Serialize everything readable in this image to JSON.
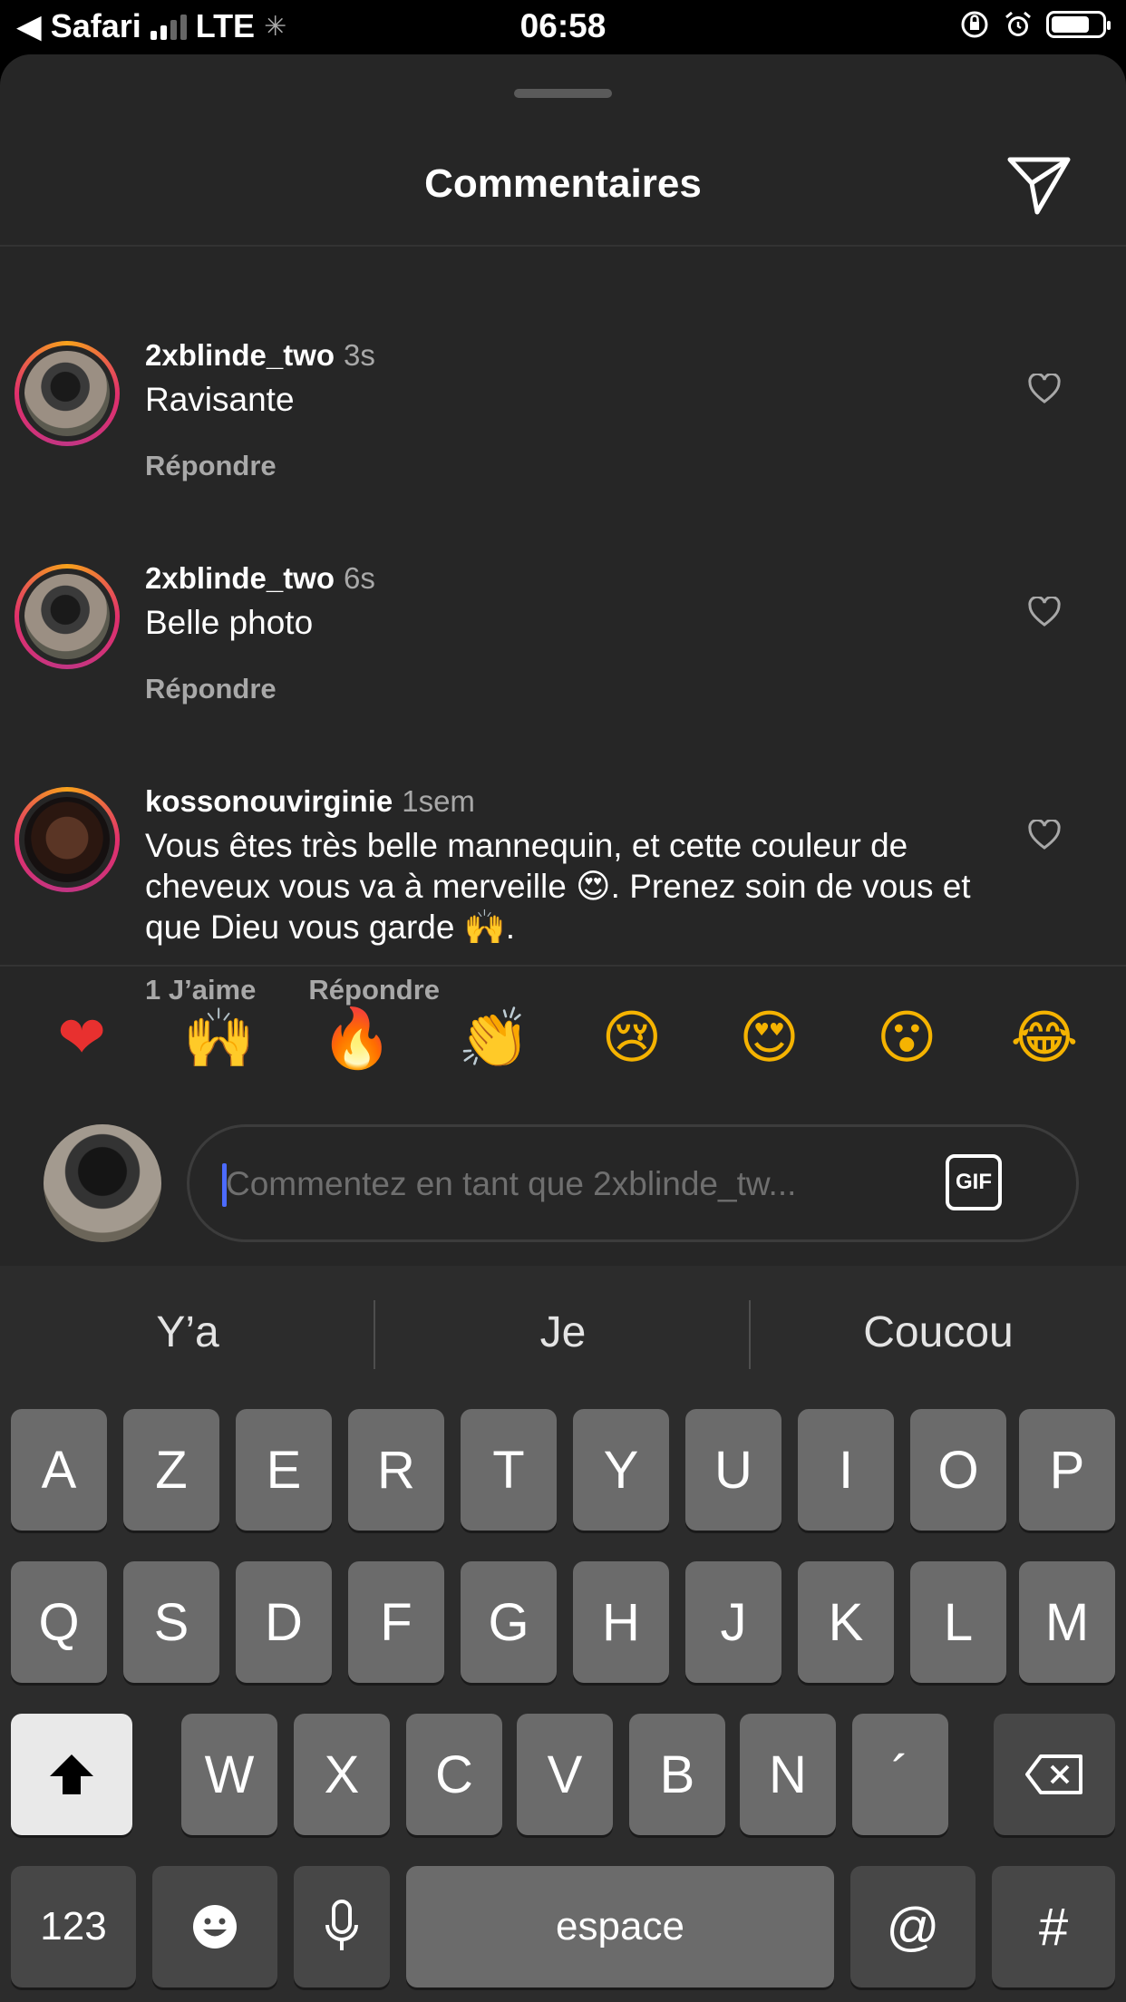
{
  "status_bar": {
    "back_label": "◀ Safari",
    "carrier": "LTE",
    "time": "06:58",
    "battery_level": 0.75
  },
  "sheet": {
    "title": "Commentaires",
    "comments": [
      {
        "username": "2xblinde_two",
        "ago": "3s",
        "text": "Ravisante",
        "actions": [
          "Répondre"
        ]
      },
      {
        "username": "2xblinde_two",
        "ago": "6s",
        "text": "Belle photo",
        "actions": [
          "Répondre"
        ]
      },
      {
        "username": "kossonouvirginie",
        "ago": "1sem",
        "text": "Vous êtes très belle mannequin, et cette couleur de cheveux vous va à merveille 😍. Prenez soin de vous et que Dieu vous garde 🙌.",
        "actions": [
          "1 J’aime",
          "Répondre"
        ]
      }
    ],
    "quick_emojis": [
      "❤",
      "🙌",
      "🔥",
      "👏",
      "😢",
      "😍",
      "😮",
      "😂"
    ],
    "composer": {
      "placeholder": "Commentez en tant que 2xblinde_tw...",
      "gif_label": "GIF"
    }
  },
  "keyboard": {
    "suggestions": [
      "Y’a",
      "Je",
      "Coucou"
    ],
    "row1": [
      "A",
      "Z",
      "E",
      "R",
      "T",
      "Y",
      "U",
      "I",
      "O",
      "P"
    ],
    "row2": [
      "Q",
      "S",
      "D",
      "F",
      "G",
      "H",
      "J",
      "K",
      "L",
      "M"
    ],
    "row3": [
      "W",
      "X",
      "C",
      "V",
      "B",
      "N",
      "´"
    ],
    "numbers_key": "123",
    "space_key": "espace",
    "at_key": "@",
    "hash_key": "#"
  }
}
